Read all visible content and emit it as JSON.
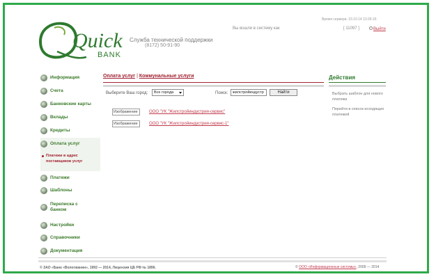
{
  "header": {
    "brand_main": "Quick",
    "brand_sub": "BANK",
    "support_title": "Служба технической поддержки",
    "support_phone": "(8172) 50-91-90",
    "server_time": "Время сервера: 23.10.14 13:26:16",
    "logged_in_as": "Вы вошли в систему как",
    "user_id": "[ 11097 ]",
    "exit_label": "Выйти"
  },
  "sidebar": {
    "items": [
      {
        "label": "Информация"
      },
      {
        "label": "Счета"
      },
      {
        "label": "Банковские карты"
      },
      {
        "label": "Вклады"
      },
      {
        "label": "Кредиты"
      },
      {
        "label": "Оплата услуг"
      },
      {
        "label": "Платежи"
      },
      {
        "label": "Шаблоны"
      },
      {
        "label": "Переписка с банком"
      },
      {
        "label": "Настройки"
      },
      {
        "label": "Справочники"
      },
      {
        "label": "Документация"
      }
    ],
    "subitem": "Платежи в адрес поставщиков услуг"
  },
  "main": {
    "tabs": [
      {
        "label": "Оплата услуг"
      },
      {
        "label": "Коммунальные услуги"
      }
    ],
    "tab_separator": "|",
    "city_label": "Выберите Ваш город:",
    "city_value": "Все города",
    "search_label": "Поиск:",
    "search_value": "жилстройиндустр",
    "find_label": "Найти",
    "results": [
      {
        "image": "Изображение",
        "name": "ООО \"УК \"Жилстройиндустрия-сервис\""
      },
      {
        "image": "Изображение",
        "name": "ООО \"УК \"Жилстройиндустрия-сервис-1\""
      }
    ]
  },
  "actions": {
    "title": "Действия",
    "items": [
      "Выбрать шаблон для нового платежа",
      "Перейти в список исходящих платежей"
    ]
  },
  "footer": {
    "copyright": "© ЗАО «Банк «Вологжанин», 1992 — 2014, Лицензия ЦБ РФ № 1896.",
    "dev_prefix": "©",
    "dev_link": "ООО «Информационные системы»",
    "dev_years": ", 2009 — 2014"
  },
  "colors": {
    "frame": "#2eaa4a",
    "brand_green": "#2e7a2e",
    "link_red": "#c0394b"
  }
}
